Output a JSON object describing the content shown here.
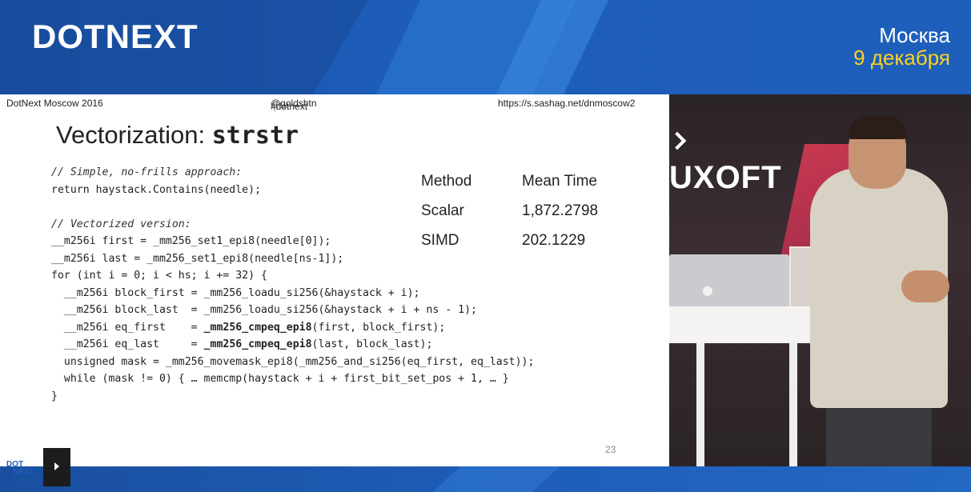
{
  "banner": {
    "logo": "DOTNEXT",
    "city": "Москва",
    "date": "9 декабря"
  },
  "slide_header": {
    "event": "DotNext Moscow 2016",
    "hashtag": "#dotnext",
    "separator": "|",
    "handle": "@goldshtn",
    "url": "https://s.sashag.net/dnmoscow2"
  },
  "slide": {
    "title_prefix": "Vectorization: ",
    "title_code": "strstr",
    "page_number": "23",
    "code_lines": [
      {
        "text": "// Simple, no-frills approach:",
        "comment": true
      },
      {
        "text": "return haystack.Contains(needle);"
      },
      {
        "text": ""
      },
      {
        "text": "// Vectorized version:",
        "comment": true
      },
      {
        "text": "__m256i first = _mm256_set1_epi8(needle[0]);"
      },
      {
        "text": "__m256i last = _mm256_set1_epi8(needle[ns-1]);"
      },
      {
        "text": "for (int i = 0; i < hs; i += 32) {"
      },
      {
        "text": "  __m256i block_first = _mm256_loadu_si256(&haystack + i);"
      },
      {
        "text": "  __m256i block_last  = _mm256_loadu_si256(&haystack + i + ns - 1);"
      },
      {
        "pre": "  __m256i eq_first    = ",
        "bold": "_mm256_cmpeq_epi8",
        "post": "(first, block_first);"
      },
      {
        "pre": "  __m256i eq_last     = ",
        "bold": "_mm256_cmpeq_epi8",
        "post": "(last, block_last);"
      },
      {
        "text": "  unsigned mask = _mm256_movemask_epi8(_mm256_and_si256(eq_first, eq_last));"
      },
      {
        "text": "  while (mask != 0) { … memcmp(haystack + i + first_bit_set_pos + 1, … }"
      },
      {
        "text": "}"
      }
    ],
    "results": {
      "headers": [
        "Method",
        "Mean Time"
      ],
      "rows": [
        [
          "Scalar",
          "1,872.2798"
        ],
        [
          "SIMD",
          "202.1229"
        ]
      ]
    }
  },
  "video": {
    "sponsor_text": "UXOFT"
  },
  "player": {
    "mini_logo_top": "DOT",
    "mini_logo_bottom": "NEXT",
    "play_icon": "play-icon"
  },
  "colors": {
    "brand_blue": "#1e5fbb",
    "date_yellow": "#ffd21f"
  }
}
